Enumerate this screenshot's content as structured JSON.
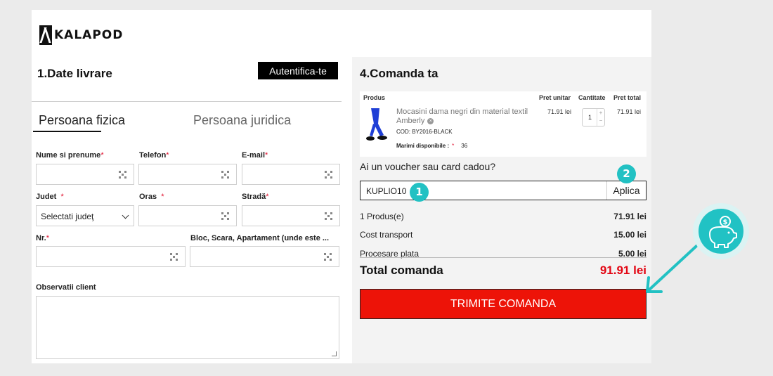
{
  "brand": {
    "logo_text": "KALAPOD"
  },
  "delivery": {
    "title": "1.Date livrare",
    "auth_button": "Autentifica-te",
    "tabs": [
      {
        "label": "Persoana fizica",
        "active": true
      },
      {
        "label": "Persoana juridica",
        "active": false
      }
    ],
    "fields": {
      "name": {
        "label": "Nume si prenume",
        "required": "*"
      },
      "phone": {
        "label": "Telefon",
        "required": "*"
      },
      "email": {
        "label": "E-mail",
        "required": "*"
      },
      "county": {
        "label": "Judet",
        "required": "*",
        "selected": "Selectati judeţ"
      },
      "city": {
        "label": "Oras",
        "required": "*"
      },
      "street": {
        "label": "Stradă",
        "required": "*"
      },
      "number": {
        "label": "Nr.",
        "required": "*"
      },
      "block": {
        "label": "Bloc, Scara, Apartament (unde este ..."
      },
      "notes": {
        "label": "Observatii client"
      }
    }
  },
  "order": {
    "title": "4.Comanda ta",
    "table_headers": {
      "product": "Produs",
      "unit_price": "Pret unitar",
      "quantity": "Cantitate",
      "total_price": "Pret total"
    },
    "item": {
      "name": "Mocasini dama negri din material textil Amberly",
      "remove_icon": "×",
      "code": "COD: BY2016-BLACK",
      "sizes_label": "Marimi disponibile :",
      "sizes_required": "*",
      "size": "36",
      "unit_price": "71.91 lei",
      "quantity": "1",
      "total_price": "71.91 lei"
    },
    "voucher": {
      "question": "Ai un voucher sau card cadou?",
      "value": "KUPLIO10",
      "apply_button": "Aplica"
    },
    "summary": [
      {
        "label": "1 Produs(e)",
        "value": "71.91 lei"
      },
      {
        "label": "Cost transport",
        "value": "15.00 lei"
      },
      {
        "label": "Procesare plata",
        "value": "5.00 lei"
      }
    ],
    "total": {
      "label": "Total comanda",
      "value": "91.91 lei"
    },
    "submit_button": "TRIMITE COMANDA"
  },
  "annotations": {
    "step1": "1",
    "step2": "2",
    "icon": "piggy-bank-coin-icon",
    "accent": "#22c1c3"
  },
  "colors": {
    "primary_red": "#ed1308",
    "total_red": "#e30613"
  }
}
